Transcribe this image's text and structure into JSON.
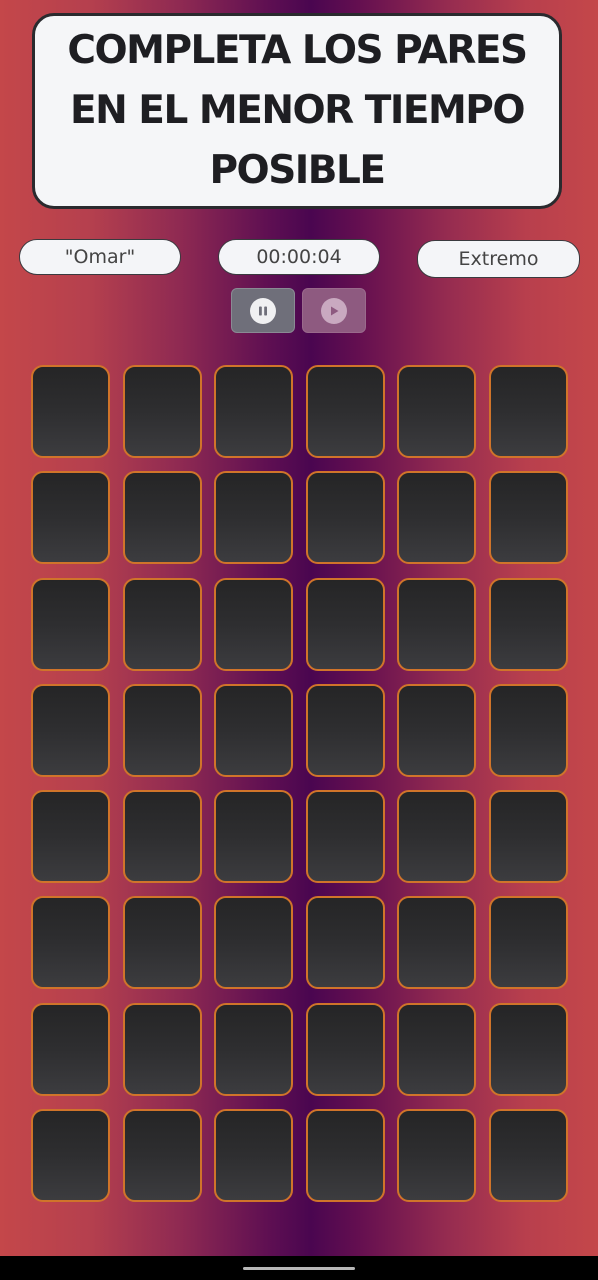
{
  "header": {
    "title": "COMPLETA LOS PARES EN EL MENOR TIEMPO POSIBLE"
  },
  "status": {
    "player_name": "\"Omar\"",
    "timer": "00:00:04",
    "level": "Extremo"
  },
  "controls": {
    "pause_icon": "pause-icon",
    "play_icon": "play-icon"
  },
  "board": {
    "rows": 8,
    "columns": 6,
    "card_state": "face-down"
  },
  "colors": {
    "card_border": "#d0742a",
    "background_center": "#4a0650",
    "background_edge": "#c4474a"
  }
}
